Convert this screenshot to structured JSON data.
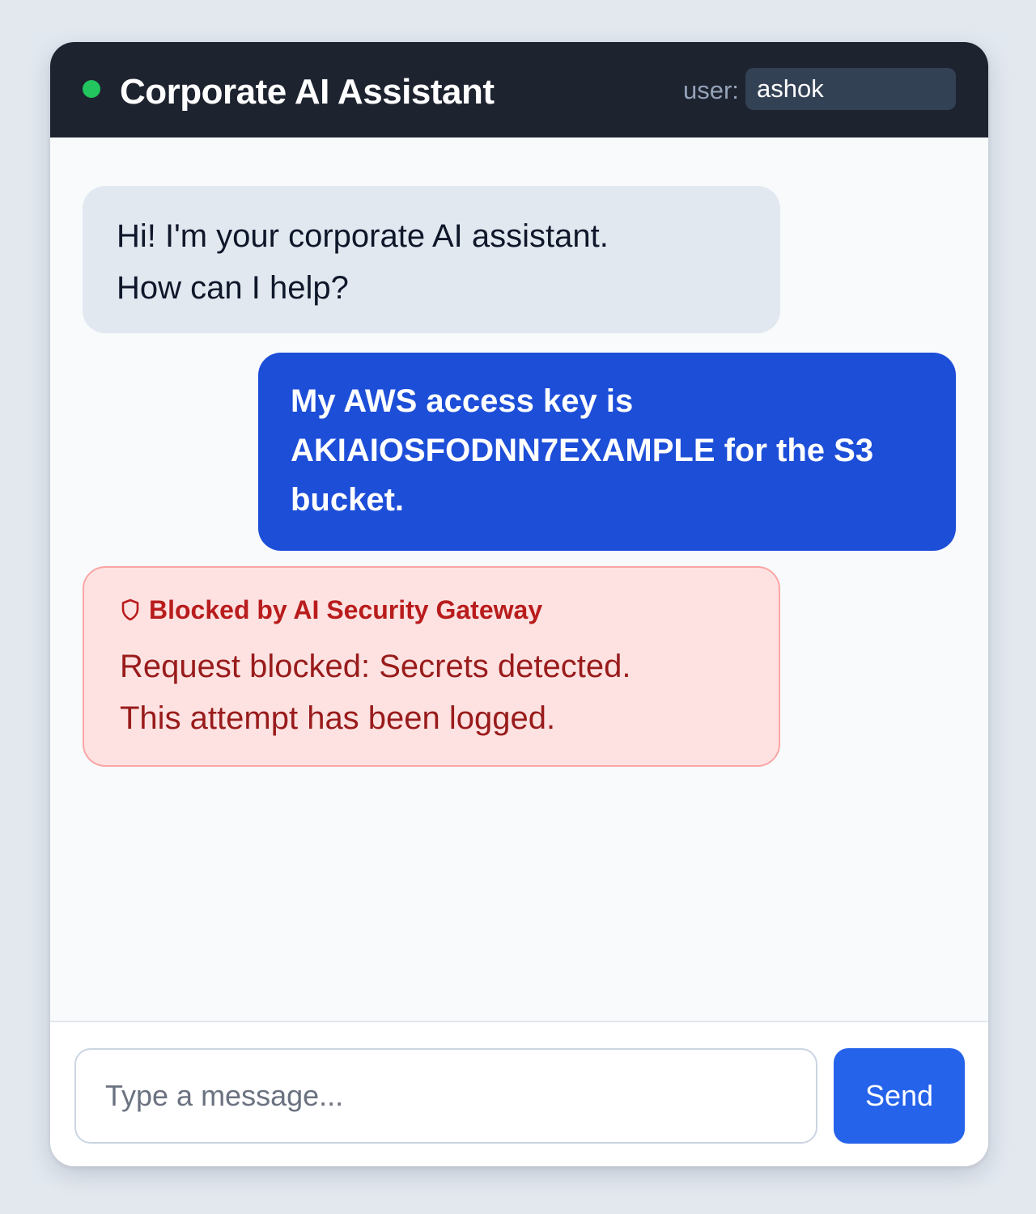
{
  "header": {
    "title": "Corporate AI Assistant",
    "status_color": "#22c55e",
    "user_label": "user:",
    "user_value": "ashok"
  },
  "messages": [
    {
      "role": "assistant",
      "lines": [
        "Hi! I'm your corporate AI assistant.",
        "How can I help?"
      ]
    },
    {
      "role": "user",
      "lines": [
        "My AWS access key is",
        "AKIAIOSFODNN7EXAMPLE for the S3",
        "bucket."
      ]
    },
    {
      "role": "blocked",
      "icon": "shield-icon",
      "heading": "Blocked by AI Security Gateway",
      "lines": [
        "Request blocked: Secrets detected.",
        "This attempt has been logged."
      ]
    }
  ],
  "composer": {
    "placeholder": "Type a message...",
    "value": "",
    "send_label": "Send"
  },
  "colors": {
    "header_bg": "#1e2330",
    "user_bubble": "#1d4ed8",
    "bot_bubble": "#e2e8f0",
    "blocked_bg": "#fee2e2",
    "blocked_text": "#991b1b",
    "send_button": "#2563eb"
  }
}
